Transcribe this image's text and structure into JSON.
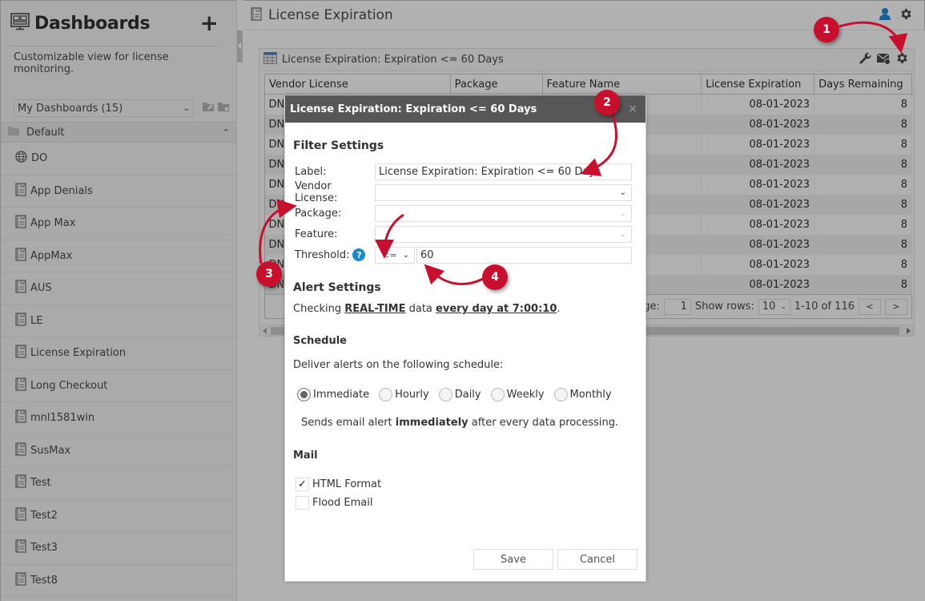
{
  "sidebar": {
    "title": "Dashboards",
    "add_label": "+",
    "description": "Customizable view for license monitoring.",
    "dashboard_select": "My Dashboards (15)",
    "group": "Default",
    "items": [
      {
        "label": "DO",
        "icon": "globe-icon"
      },
      {
        "label": "App Denials",
        "icon": "report-icon"
      },
      {
        "label": "App Max",
        "icon": "report-icon"
      },
      {
        "label": "AppMax",
        "icon": "report-icon"
      },
      {
        "label": "AUS",
        "icon": "report-icon"
      },
      {
        "label": "LE",
        "icon": "report-icon"
      },
      {
        "label": "License Expiration",
        "icon": "report-icon"
      },
      {
        "label": "Long Checkout",
        "icon": "report-icon"
      },
      {
        "label": "mnl1581win",
        "icon": "report-icon"
      },
      {
        "label": "SusMax",
        "icon": "report-icon"
      },
      {
        "label": "Test",
        "icon": "report-icon"
      },
      {
        "label": "Test2",
        "icon": "report-icon"
      },
      {
        "label": "Test3",
        "icon": "report-icon"
      },
      {
        "label": "Test8",
        "icon": "report-icon"
      }
    ]
  },
  "main": {
    "title": "License Expiration",
    "widget": {
      "title": "License Expiration: Expiration <= 60 Days",
      "columns": [
        "Vendor License",
        "Package",
        "Feature Name",
        "License Expiration",
        "Days Remaining"
      ],
      "rows": [
        [
          "DN",
          "",
          "",
          "08-01-2023",
          "8"
        ],
        [
          "DN",
          "",
          "",
          "08-01-2023",
          "8"
        ],
        [
          "DN",
          "",
          "",
          "08-01-2023",
          "8"
        ],
        [
          "DN",
          "",
          "",
          "08-01-2023",
          "8"
        ],
        [
          "DN",
          "",
          "",
          "08-01-2023",
          "8"
        ],
        [
          "DN",
          "",
          "",
          "08-01-2023",
          "8"
        ],
        [
          "DN",
          "",
          "",
          "08-01-2023",
          "8"
        ],
        [
          "DN",
          "",
          "",
          "08-01-2023",
          "8"
        ],
        [
          "DN",
          "",
          "",
          "08-01-2023",
          "8"
        ],
        [
          "DN",
          "",
          "",
          "08-01-2023",
          "8"
        ]
      ],
      "pager": {
        "page_label": "Page:",
        "page_value": "1",
        "show_rows_label": "Show rows:",
        "rows_value": "10",
        "range_text": "1-10 of 116",
        "prev": "<",
        "next": ">"
      }
    }
  },
  "modal": {
    "title": "License Expiration: Expiration <= 60 Days",
    "close": "×",
    "filter_settings": "Filter Settings",
    "label_label": "Label:",
    "label_value": "License Expiration: Expiration <= 60 Days",
    "vendor_label": "Vendor License:",
    "vendor_value": "",
    "package_label": "Package:",
    "package_value": "",
    "feature_label": "Feature:",
    "feature_value": "",
    "threshold_label": "Threshold:",
    "threshold_operator": "<=",
    "threshold_value": "60",
    "alert_settings": "Alert Settings",
    "checking_prefix": "Checking ",
    "checking_source": "REAL-TIME",
    "checking_mid": " data ",
    "checking_when": "every day at 7:00:10",
    "checking_suffix": ".",
    "schedule_title": "Schedule",
    "schedule_desc": "Deliver alerts on the following schedule:",
    "schedule_options": [
      {
        "label": "Immediate",
        "selected": true
      },
      {
        "label": "Hourly",
        "selected": false
      },
      {
        "label": "Daily",
        "selected": false
      },
      {
        "label": "Weekly",
        "selected": false
      },
      {
        "label": "Monthly",
        "selected": false
      }
    ],
    "schedule_note_prefix": "Sends email alert ",
    "schedule_note_bold": "immediately",
    "schedule_note_suffix": " after every data processing.",
    "mail_title": "Mail",
    "mail_options": [
      {
        "label": "HTML Format",
        "checked": true
      },
      {
        "label": "Flood Email",
        "checked": false
      }
    ],
    "save": "Save",
    "cancel": "Cancel"
  },
  "callouts": [
    "1",
    "2",
    "3",
    "4"
  ],
  "colors": {
    "callout": "#c8102e",
    "modal_header": "#575757",
    "help_icon": "#1a8ad0",
    "user_icon": "#1a5f99"
  }
}
